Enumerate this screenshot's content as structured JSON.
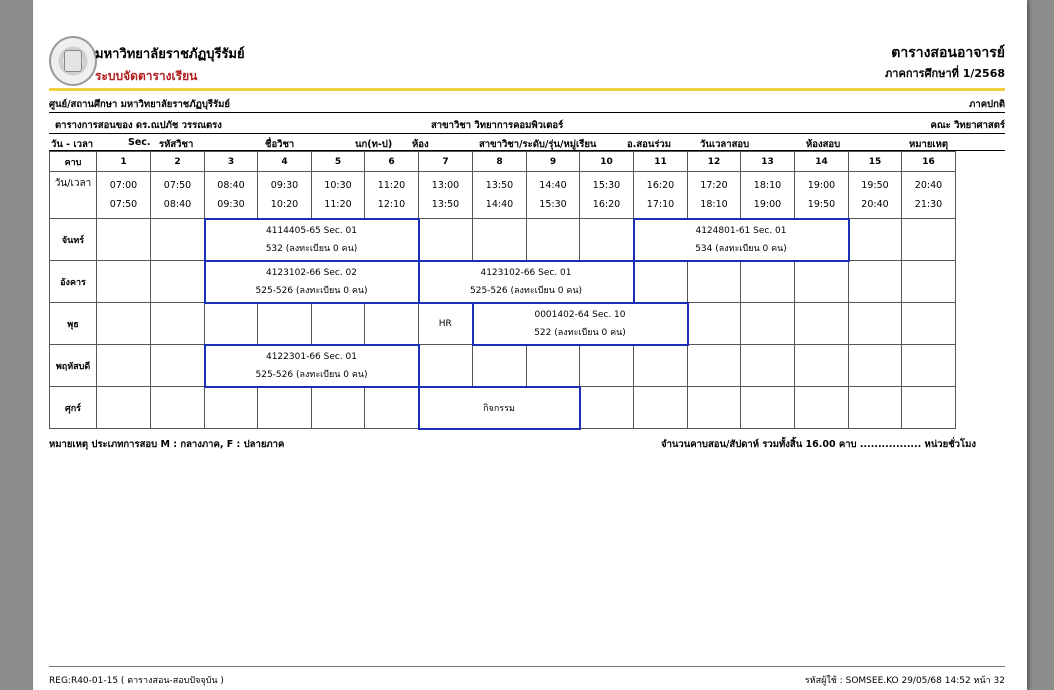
{
  "header": {
    "university": "มหาวิทยาลัยราชภัฏบุรีรัมย์",
    "system": "ระบบจัดตารางเรียน",
    "doc_title": "ตารางสอนอาจารย์",
    "semester": "ภาคการศึกษาที่  1/2568"
  },
  "info": {
    "center": "ศูนย์/สถานศึกษา มหาวิทยาลัยราชภัฏบุรีรัมย์",
    "mode": "ภาคปกติ",
    "teacher": "ตารางการสอนของ  ดร.ณปภัช  วรรณตรง",
    "major": "สาขาวิชา วิทยาการคอมพิวเตอร์",
    "faculty": "คณะ วิทยาศาสตร์"
  },
  "columns": {
    "day_time": "วัน - เวลา",
    "sec": "Sec.",
    "code": "รหัสวิชา",
    "name": "ชื่อวิชา",
    "credit": "นก(ท-ป)",
    "room": "ห้อง",
    "major_level": "สาขาวิชา/ระดับ/รุ่น/หมู่เรียน",
    "co_teacher": "อ.สอนร่วม",
    "exam_time": "วันเวลาสอบ",
    "exam_room": "ห้องสอบ",
    "remark": "หมายเหตุ"
  },
  "grid": {
    "period_label": "คาบ",
    "time_label": "วัน/เวลา",
    "periods": [
      "1",
      "2",
      "3",
      "4",
      "5",
      "6",
      "7",
      "8",
      "9",
      "10",
      "11",
      "12",
      "13",
      "14",
      "15",
      "16"
    ],
    "start_times": [
      "07:00",
      "07:50",
      "08:40",
      "09:30",
      "10:30",
      "11:20",
      "13:00",
      "13:50",
      "14:40",
      "15:30",
      "16:20",
      "17:20",
      "18:10",
      "19:00",
      "19:50",
      "20:40"
    ],
    "end_times": [
      "07:50",
      "08:40",
      "09:30",
      "10:20",
      "11:20",
      "12:10",
      "13:50",
      "14:40",
      "15:30",
      "16:20",
      "17:10",
      "18:10",
      "19:00",
      "19:50",
      "20:40",
      "21:30"
    ],
    "days": [
      "จันทร์",
      "อังคาร",
      "พุธ",
      "พฤหัสบดี",
      "ศุกร์"
    ]
  },
  "courses": {
    "mon_a": {
      "code": "4114405-65 Sec. 01",
      "room": "532 (ลงทะเบียน 0 คน)"
    },
    "mon_b": {
      "code": "4124801-61 Sec. 01",
      "room": "534 (ลงทะเบียน 0 คน)"
    },
    "tue_a": {
      "code": "4123102-66 Sec. 02",
      "room": "525-526 (ลงทะเบียน 0 คน)"
    },
    "tue_b": {
      "code": "4123102-66 Sec. 01",
      "room": "525-526 (ลงทะเบียน 0 คน)"
    },
    "wed_hr": "HR",
    "wed_a": {
      "code": "0001402-64 Sec. 10",
      "room": "522 (ลงทะเบียน 0 คน)"
    },
    "thu_a": {
      "code": "4122301-66 Sec. 01",
      "room": "525-526 (ลงทะเบียน 0 คน)"
    },
    "fri_activity": "กิจกรรม"
  },
  "notes": {
    "left": "หมายเหตุ ประเภทการสอบ M : กลางภาค, F : ปลายภาค",
    "right": "จำนวนคาบสอน/สัปดาห์  รวมทั้งสิ้น     16.00  คาบ  .................  หน่วยชั่วโมง"
  },
  "footer": {
    "left": "REG:R40-01-15 ( ตารางสอน-สอบปัจจุบัน )",
    "right": "รหัสผู้ใช้ : SOMSEE.KO   29/05/68 14:52  หน้า 32"
  }
}
